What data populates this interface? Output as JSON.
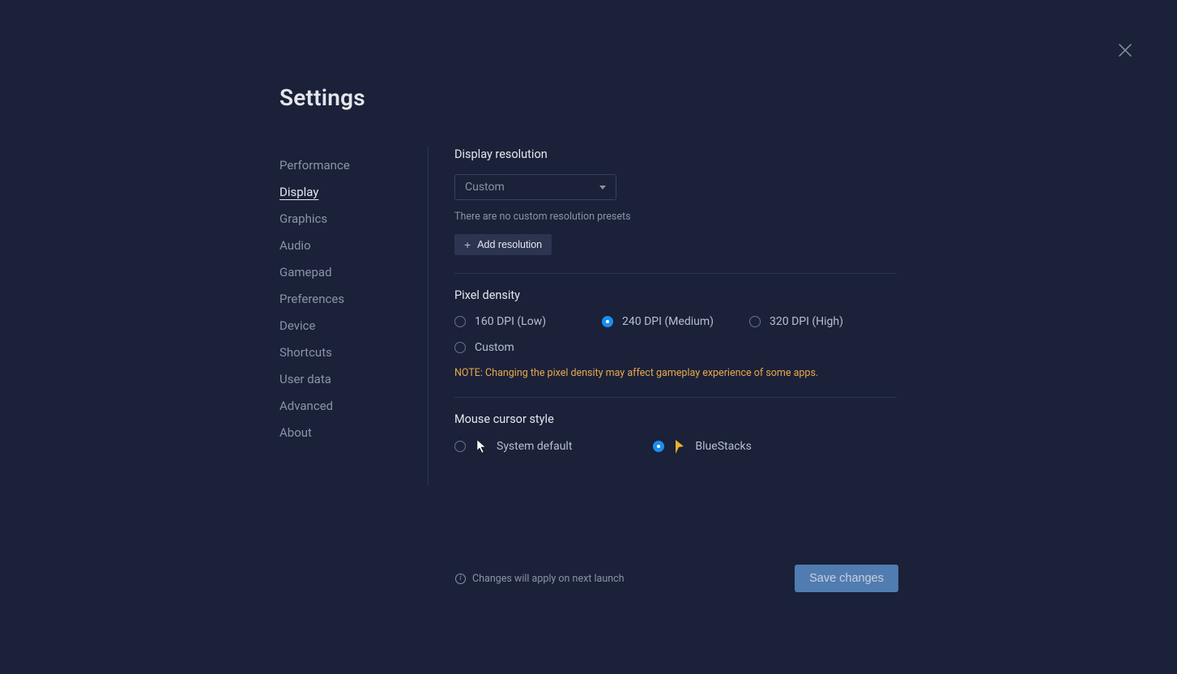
{
  "title": "Settings",
  "sidebar": {
    "items": [
      "Performance",
      "Display",
      "Graphics",
      "Audio",
      "Gamepad",
      "Preferences",
      "Device",
      "Shortcuts",
      "User data",
      "Advanced",
      "About"
    ],
    "active_index": 1
  },
  "sections": {
    "display_resolution": {
      "title": "Display resolution",
      "dropdown_value": "Custom",
      "preset_note": "There are no custom resolution presets",
      "add_label": "Add resolution"
    },
    "pixel_density": {
      "title": "Pixel density",
      "options": [
        "160 DPI (Low)",
        "240 DPI (Medium)",
        "320 DPI (High)",
        "Custom"
      ],
      "selected_index": 1,
      "warning": "NOTE: Changing the pixel density may affect gameplay experience of some apps."
    },
    "mouse_cursor": {
      "title": "Mouse cursor style",
      "options": [
        "System default",
        "BlueStacks"
      ],
      "selected_index": 1
    }
  },
  "footer": {
    "note": "Changes will apply on next launch",
    "save_label": "Save changes"
  }
}
